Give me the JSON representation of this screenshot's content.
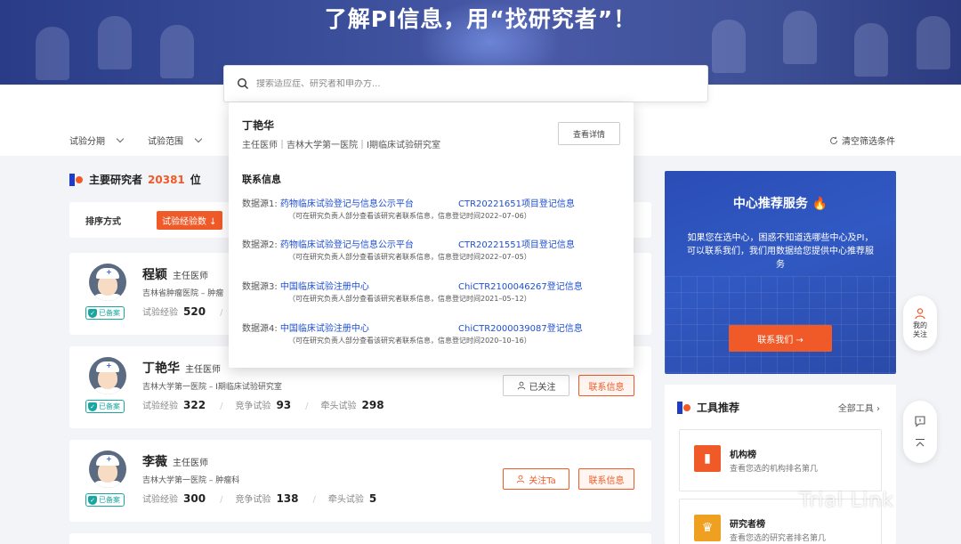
{
  "hero": {
    "title": "了解PI信息，用“找研究者”！"
  },
  "search": {
    "placeholder": "搜索适应症、研究者和申办方..."
  },
  "filters": {
    "phase": "试验分期",
    "scope": "试验范围",
    "clear": "清空筛选条件"
  },
  "section": {
    "title": "主要研究者",
    "count": "20381",
    "unit": "位"
  },
  "sort": {
    "label": "排序方式",
    "active": "试验经验数 ↓"
  },
  "investigators": [
    {
      "name": "程颖",
      "title": "主任医师",
      "org": "吉林省肿瘤医院 – 肿瘤",
      "exp_label": "试验经验",
      "exp": "520",
      "comp_label": "",
      "comp": "",
      "lead_label": "",
      "lead": "",
      "badge": "已备案"
    },
    {
      "name": "丁艳华",
      "title": "主任医师",
      "org": "吉林大学第一医院 – I期临床试验研究室",
      "exp_label": "试验经验",
      "exp": "322",
      "comp_label": "竞争试验",
      "comp": "93",
      "lead_label": "牵头试验",
      "lead": "298",
      "badge": "已备案",
      "follow": "已关注",
      "contact": "联系信息"
    },
    {
      "name": "李薇",
      "title": "主任医师",
      "org": "吉林大学第一医院 – 肿瘤科",
      "exp_label": "试验经验",
      "exp": "300",
      "comp_label": "竞争试验",
      "comp": "138",
      "lead_label": "牵头试验",
      "lead": "5",
      "badge": "已备案",
      "follow": "关注Ta",
      "contact": "联系信息"
    }
  ],
  "dropdown": {
    "name": "丁艳华",
    "sub": "主任医师｜吉林大学第一医院｜I期临床试验研究室",
    "detail_btn": "查看详情",
    "contact_title": "联系信息",
    "sources": [
      {
        "label": "数据源1:",
        "platform": "药物临床试验登记与信息公示平台",
        "reg": "CTR20221651项目登记信息",
        "note": "（可在研究负责人部分查看该研究者联系信息，信息登记时间2022–07–06）"
      },
      {
        "label": "数据源2:",
        "platform": "药物临床试验登记与信息公示平台",
        "reg": "CTR20221551项目登记信息",
        "note": "（可在研究负责人部分查看该研究者联系信息，信息登记时间2022–07–05）"
      },
      {
        "label": "数据源3:",
        "platform": "中国临床试验注册中心",
        "reg": "ChiCTR2100046267登记信息",
        "note": "（可在研究负责人部分查看该研究者联系信息，信息登记时间2021–05–12）"
      },
      {
        "label": "数据源4:",
        "platform": "中国临床试验注册中心",
        "reg": "ChiCTR2000039087登记信息",
        "note": "（可在研究负责人部分查看该研究者联系信息，信息登记时间2020–10–16）"
      }
    ]
  },
  "promo": {
    "title": "中心推荐服务 🔥",
    "desc": "如果您在选中心，困惑不知道选哪些中心及PI，可以联系我们，我们用数据给您提供中心推荐服务",
    "button": "联系我们 →"
  },
  "tools": {
    "title": "工具推荐",
    "all": "全部工具",
    "items": [
      {
        "name": "机构榜",
        "desc": "查看您选的机构排名第几",
        "color": "#f05a28"
      },
      {
        "name": "研究者榜",
        "desc": "查看您选的研究者排名第几",
        "color": "#f0a020"
      }
    ]
  },
  "side": {
    "follow": "我的\n关注"
  },
  "watermark": "Trial Link"
}
